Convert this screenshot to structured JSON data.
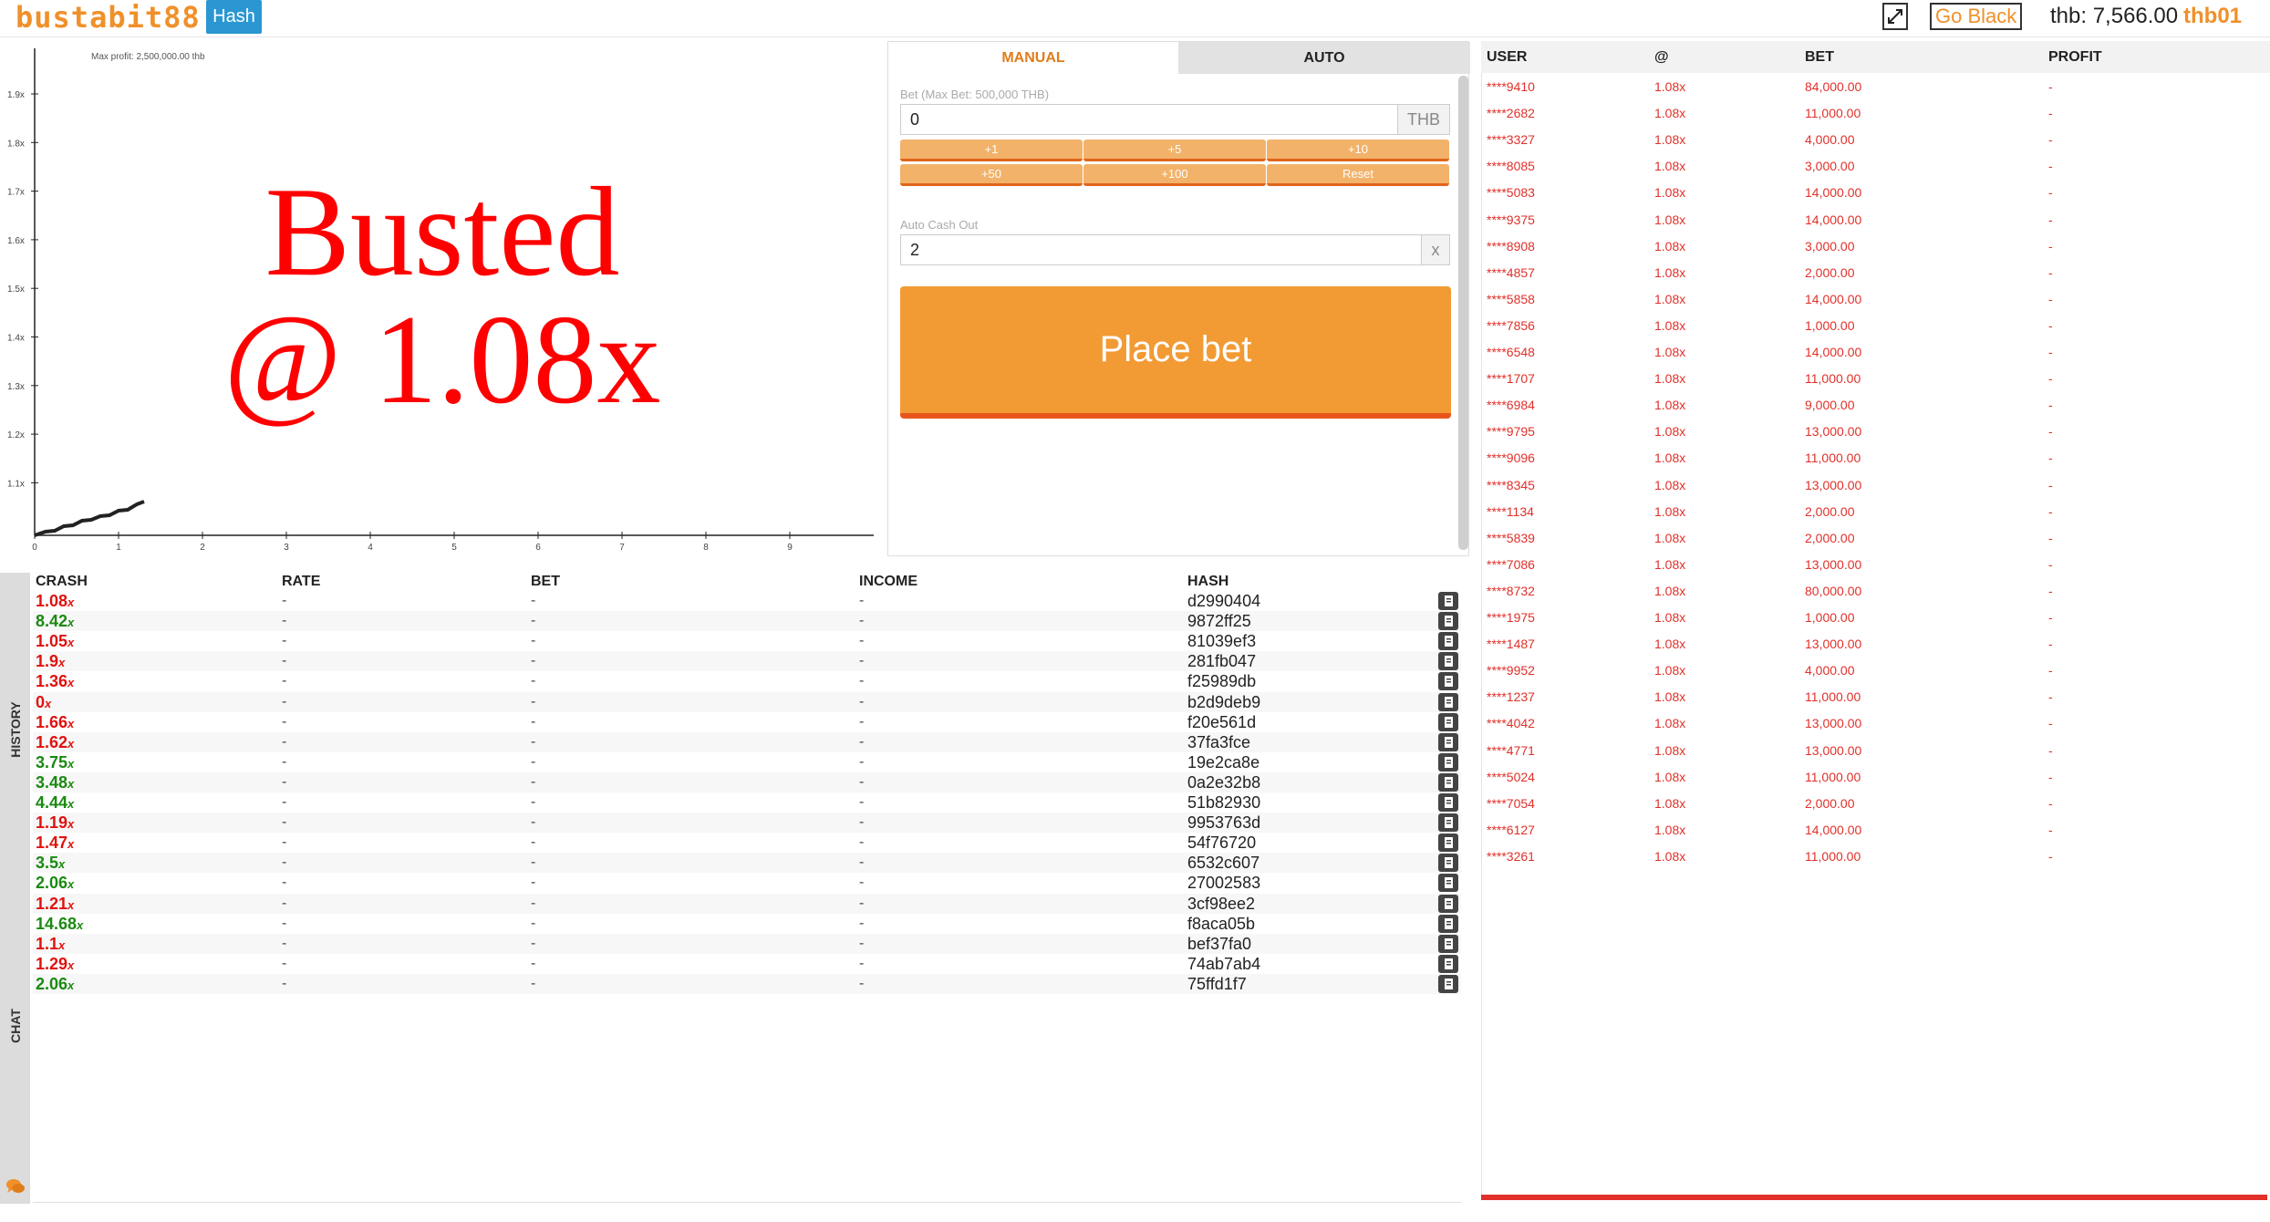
{
  "header": {
    "logo": "bustabit88",
    "hash_label": "Hash",
    "go_black_label": "Go Black",
    "balance": "thb: 7,566.00",
    "username": "thb01"
  },
  "graph": {
    "max_profit": "Max profit: 2,500,000.00 thb",
    "busted_line1": "Busted",
    "busted_line2": "@ 1.08x",
    "y_ticks": [
      "1.9x",
      "1.8x",
      "1.7x",
      "1.6x",
      "1.5x",
      "1.4x",
      "1.3x",
      "1.2x",
      "1.1x"
    ],
    "x_ticks": [
      "0",
      "1",
      "2",
      "3",
      "4",
      "5",
      "6",
      "7",
      "8",
      "9"
    ],
    "curve_color": "#222222"
  },
  "controls": {
    "tabs": [
      "MANUAL",
      "AUTO"
    ],
    "bet_label": "Bet (Max Bet: 500,000 THB)",
    "bet_value": "0",
    "bet_unit": "THB",
    "quick_buttons": [
      "+1",
      "+5",
      "+10",
      "+50",
      "+100",
      "Reset"
    ],
    "cashout_label": "Auto Cash Out",
    "cashout_value": "2",
    "cashout_unit": "x",
    "place_bet": "Place bet"
  },
  "players": {
    "headers": [
      "USER",
      "@",
      "BET",
      "PROFIT"
    ],
    "rows": [
      {
        "user": "****9410",
        "at": "1.08x",
        "bet": "84,000.00",
        "profit": "-"
      },
      {
        "user": "****2682",
        "at": "1.08x",
        "bet": "11,000.00",
        "profit": "-"
      },
      {
        "user": "****3327",
        "at": "1.08x",
        "bet": "4,000.00",
        "profit": "-"
      },
      {
        "user": "****8085",
        "at": "1.08x",
        "bet": "3,000.00",
        "profit": "-"
      },
      {
        "user": "****5083",
        "at": "1.08x",
        "bet": "14,000.00",
        "profit": "-"
      },
      {
        "user": "****9375",
        "at": "1.08x",
        "bet": "14,000.00",
        "profit": "-"
      },
      {
        "user": "****8908",
        "at": "1.08x",
        "bet": "3,000.00",
        "profit": "-"
      },
      {
        "user": "****4857",
        "at": "1.08x",
        "bet": "2,000.00",
        "profit": "-"
      },
      {
        "user": "****5858",
        "at": "1.08x",
        "bet": "14,000.00",
        "profit": "-"
      },
      {
        "user": "****7856",
        "at": "1.08x",
        "bet": "1,000.00",
        "profit": "-"
      },
      {
        "user": "****6548",
        "at": "1.08x",
        "bet": "14,000.00",
        "profit": "-"
      },
      {
        "user": "****1707",
        "at": "1.08x",
        "bet": "11,000.00",
        "profit": "-"
      },
      {
        "user": "****6984",
        "at": "1.08x",
        "bet": "9,000.00",
        "profit": "-"
      },
      {
        "user": "****9795",
        "at": "1.08x",
        "bet": "13,000.00",
        "profit": "-"
      },
      {
        "user": "****9096",
        "at": "1.08x",
        "bet": "11,000.00",
        "profit": "-"
      },
      {
        "user": "****8345",
        "at": "1.08x",
        "bet": "13,000.00",
        "profit": "-"
      },
      {
        "user": "****1134",
        "at": "1.08x",
        "bet": "2,000.00",
        "profit": "-"
      },
      {
        "user": "****5839",
        "at": "1.08x",
        "bet": "2,000.00",
        "profit": "-"
      },
      {
        "user": "****7086",
        "at": "1.08x",
        "bet": "13,000.00",
        "profit": "-"
      },
      {
        "user": "****8732",
        "at": "1.08x",
        "bet": "80,000.00",
        "profit": "-"
      },
      {
        "user": "****1975",
        "at": "1.08x",
        "bet": "1,000.00",
        "profit": "-"
      },
      {
        "user": "****1487",
        "at": "1.08x",
        "bet": "13,000.00",
        "profit": "-"
      },
      {
        "user": "****9952",
        "at": "1.08x",
        "bet": "4,000.00",
        "profit": "-"
      },
      {
        "user": "****1237",
        "at": "1.08x",
        "bet": "11,000.00",
        "profit": "-"
      },
      {
        "user": "****4042",
        "at": "1.08x",
        "bet": "13,000.00",
        "profit": "-"
      },
      {
        "user": "****4771",
        "at": "1.08x",
        "bet": "13,000.00",
        "profit": "-"
      },
      {
        "user": "****5024",
        "at": "1.08x",
        "bet": "11,000.00",
        "profit": "-"
      },
      {
        "user": "****7054",
        "at": "1.08x",
        "bet": "2,000.00",
        "profit": "-"
      },
      {
        "user": "****6127",
        "at": "1.08x",
        "bet": "14,000.00",
        "profit": "-"
      },
      {
        "user": "****3261",
        "at": "1.08x",
        "bet": "11,000.00",
        "profit": "-"
      }
    ]
  },
  "history": {
    "tab_history": "HISTORY",
    "tab_chat": "CHAT",
    "headers": [
      "CRASH",
      "RATE",
      "BET",
      "INCOME",
      "HASH"
    ],
    "rows": [
      {
        "crash": "1.08",
        "color": "red",
        "rate": "-",
        "bet": "-",
        "income": "-",
        "hash": "d2990404"
      },
      {
        "crash": "8.42",
        "color": "green",
        "rate": "-",
        "bet": "-",
        "income": "-",
        "hash": "9872ff25"
      },
      {
        "crash": "1.05",
        "color": "red",
        "rate": "-",
        "bet": "-",
        "income": "-",
        "hash": "81039ef3"
      },
      {
        "crash": "1.9",
        "color": "red",
        "rate": "-",
        "bet": "-",
        "income": "-",
        "hash": "281fb047"
      },
      {
        "crash": "1.36",
        "color": "red",
        "rate": "-",
        "bet": "-",
        "income": "-",
        "hash": "f25989db"
      },
      {
        "crash": "0",
        "color": "red",
        "rate": "-",
        "bet": "-",
        "income": "-",
        "hash": "b2d9deb9"
      },
      {
        "crash": "1.66",
        "color": "red",
        "rate": "-",
        "bet": "-",
        "income": "-",
        "hash": "f20e561d"
      },
      {
        "crash": "1.62",
        "color": "red",
        "rate": "-",
        "bet": "-",
        "income": "-",
        "hash": "37fa3fce"
      },
      {
        "crash": "3.75",
        "color": "green",
        "rate": "-",
        "bet": "-",
        "income": "-",
        "hash": "19e2ca8e"
      },
      {
        "crash": "3.48",
        "color": "green",
        "rate": "-",
        "bet": "-",
        "income": "-",
        "hash": "0a2e32b8"
      },
      {
        "crash": "4.44",
        "color": "green",
        "rate": "-",
        "bet": "-",
        "income": "-",
        "hash": "51b82930"
      },
      {
        "crash": "1.19",
        "color": "red",
        "rate": "-",
        "bet": "-",
        "income": "-",
        "hash": "9953763d"
      },
      {
        "crash": "1.47",
        "color": "red",
        "rate": "-",
        "bet": "-",
        "income": "-",
        "hash": "54f76720"
      },
      {
        "crash": "3.5",
        "color": "green",
        "rate": "-",
        "bet": "-",
        "income": "-",
        "hash": "6532c607"
      },
      {
        "crash": "2.06",
        "color": "green",
        "rate": "-",
        "bet": "-",
        "income": "-",
        "hash": "27002583"
      },
      {
        "crash": "1.21",
        "color": "red",
        "rate": "-",
        "bet": "-",
        "income": "-",
        "hash": "3cf98ee2"
      },
      {
        "crash": "14.68",
        "color": "green",
        "rate": "-",
        "bet": "-",
        "income": "-",
        "hash": "f8aca05b"
      },
      {
        "crash": "1.1",
        "color": "red",
        "rate": "-",
        "bet": "-",
        "income": "-",
        "hash": "bef37fa0"
      },
      {
        "crash": "1.29",
        "color": "red",
        "rate": "-",
        "bet": "-",
        "income": "-",
        "hash": "74ab7ab4"
      },
      {
        "crash": "2.06",
        "color": "green",
        "rate": "-",
        "bet": "-",
        "income": "-",
        "hash": "75ffd1f7"
      }
    ],
    "crash_suffix": "x"
  }
}
